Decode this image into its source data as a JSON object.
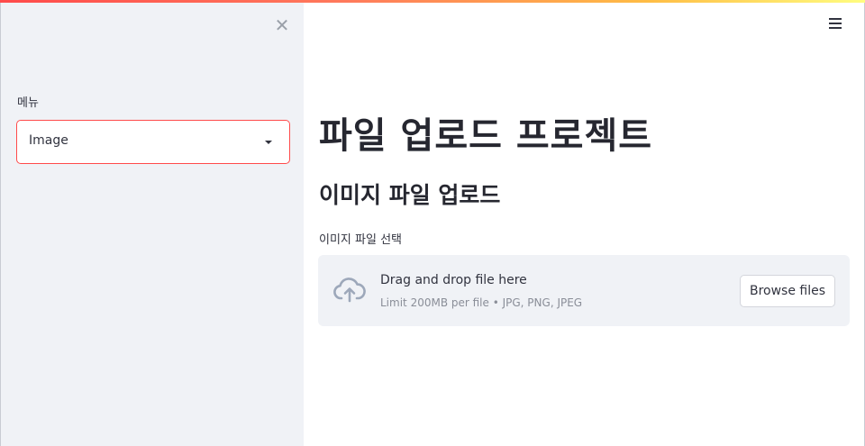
{
  "sidebar": {
    "close_symbol": "✕",
    "menu_label": "메뉴",
    "select": {
      "value": "Image"
    }
  },
  "header": {
    "menu_icon": "hamburger-icon"
  },
  "main": {
    "title": "파일 업로드 프로젝트",
    "section_title": "이미지 파일 업로드",
    "uploader": {
      "label": "이미지 파일 선택",
      "drop_text": "Drag and drop file here",
      "limit_text": "Limit 200MB per file • JPG, PNG, JPEG",
      "browse_label": "Browse files",
      "icon": "cloud-upload-icon"
    }
  },
  "colors": {
    "accent": "#ff4b4b",
    "sidebar_bg": "#f0f2f6",
    "text": "#262730"
  }
}
